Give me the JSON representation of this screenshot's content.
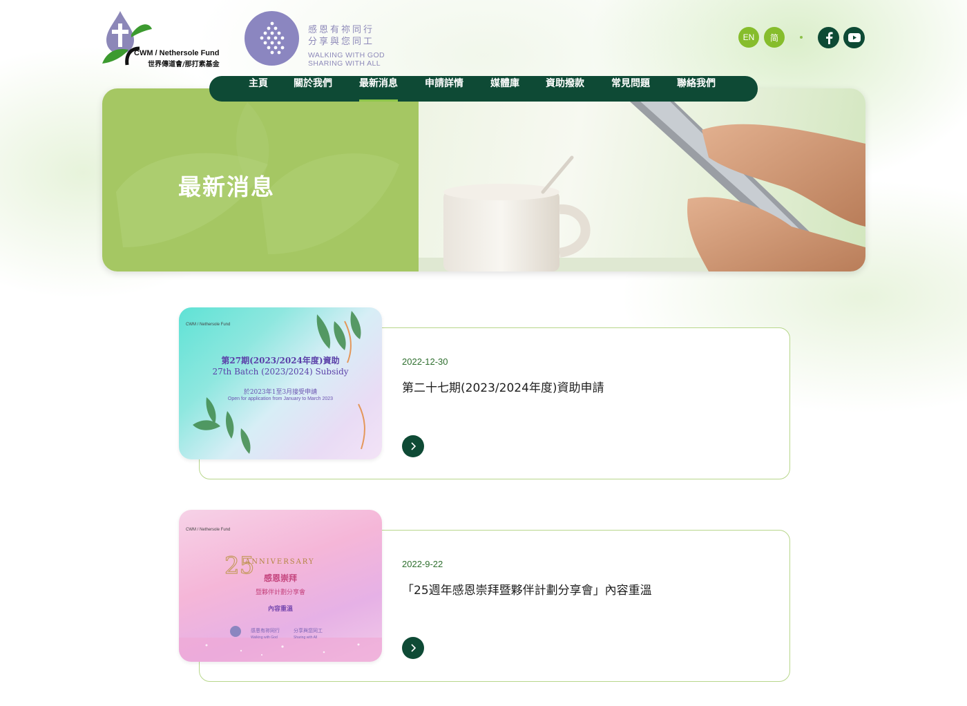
{
  "header": {
    "logo_cwm": {
      "name_en": "CWM / Nethersole Fund",
      "name_zh": "世界傳道會/那打素基金"
    },
    "logo_walk": {
      "zh_line1": "感恩有祢同行",
      "zh_line2": "分享與您同工",
      "en_line1": "WALKING  WITH GOD",
      "en_line2": "SHARING WITH ALL"
    },
    "lang": {
      "en": "EN",
      "sc": "简"
    },
    "social": {
      "facebook": "facebook-icon",
      "youtube": "youtube-icon"
    }
  },
  "nav": {
    "items": [
      {
        "label": "主頁"
      },
      {
        "label": "關於我們"
      },
      {
        "label": "最新消息"
      },
      {
        "label": "申請詳情"
      },
      {
        "label": "媒體庫"
      },
      {
        "label": "資助撥款"
      },
      {
        "label": "常見問題"
      },
      {
        "label": "聯絡我們"
      }
    ],
    "active": "最新消息"
  },
  "banner": {
    "title": "最新消息"
  },
  "news": [
    {
      "date": "2022-12-30",
      "title": "第二十七期(2023/2024年度)資助申請",
      "thumb": {
        "line1": "第27期(2023/2024年度)資助",
        "line2": "27th Batch (2023/2024) Subsidy",
        "line3": "於2023年1至3月接受申請",
        "line4": "Open for application from January to March 2023"
      }
    },
    {
      "date": "2022-9-22",
      "title": "「25週年感恩崇拜暨夥伴計劃分享會」內容重溫",
      "thumb": {
        "line1": "ANNIVERSARY",
        "line2": "感恩崇拜",
        "line3": "暨夥伴計劃分享會",
        "line4": "內容重溫",
        "foot1": "感恩有祢同行",
        "foot2": "分享與您同工",
        "foot3": "Walking with God",
        "foot4": "Sharing with All"
      }
    }
  ],
  "colors": {
    "brand_dark": "#0e4a35",
    "brand_green": "#86bd2c",
    "banner_green": "#a5c763",
    "logo_purple": "#8b86c0"
  }
}
